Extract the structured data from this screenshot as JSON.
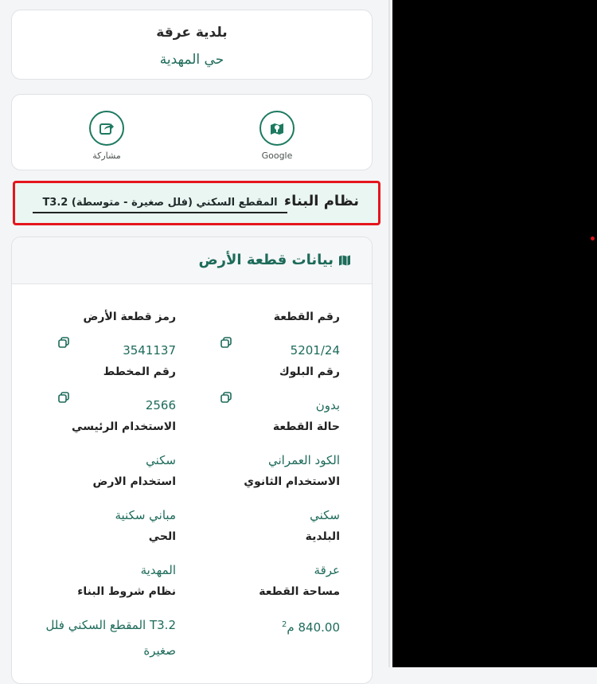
{
  "header": {
    "municipality": "بلدية عرقة",
    "district": "حي المهدية"
  },
  "actions": [
    {
      "label": "Google",
      "icon": "map-pin-icon"
    },
    {
      "label": "مشاركة",
      "icon": "share-icon"
    }
  ],
  "building_system": {
    "label": "نظام البناء",
    "value": "T3.2 المقطع السكني (فلل صغيرة - متوسطة)",
    "highlight_color": "#e5151d"
  },
  "land_data": {
    "title": "بيانات قطعة الأرض",
    "fields": {
      "plot_number": {
        "label": "رقم القطعة",
        "value": "5201/24"
      },
      "plot_code": {
        "label": "رمز قطعة الأرض",
        "value": "3541137"
      },
      "block_number": {
        "label": "رقم البلوك",
        "value": "بدون"
      },
      "plan_number": {
        "label": "رقم المخطط",
        "value": "2566"
      },
      "plot_status": {
        "label": "حالة القطعة",
        "value": "الكود العمراني"
      },
      "main_use": {
        "label": "الاستخدام الرئيسي",
        "value": "سكني"
      },
      "secondary_use": {
        "label": "الاستخدام الثانوي",
        "value": "سكني"
      },
      "land_use": {
        "label": "استخدام الارض",
        "value": "مباني سكنية"
      },
      "municipality": {
        "label": "البلدية",
        "value": "عرقة"
      },
      "district": {
        "label": "الحي",
        "value": "المهدية"
      },
      "area": {
        "label": "مساحة القطعة",
        "value": "840.00",
        "unit": "م",
        "unit_sup": "2"
      },
      "building_terms": {
        "label": "نظام شروط البناء",
        "value": "T3.2 المقطع السكني فلل صغيرة"
      }
    }
  },
  "colors": {
    "accent": "#1d6b5a",
    "icon": "#1d7a60"
  }
}
